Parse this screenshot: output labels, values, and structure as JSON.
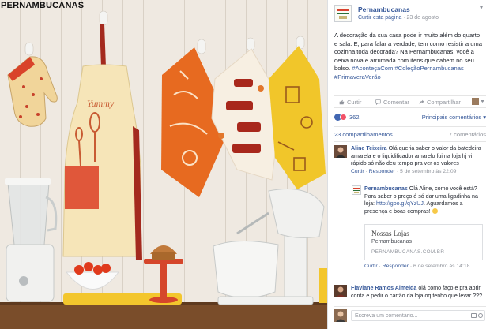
{
  "photo": {
    "brand_overlay": "PERNAMBUCANAS",
    "apron_text": "Yummy"
  },
  "post": {
    "page_name": "Pernambucanas",
    "like_page": "Curtir esta página",
    "separator": "·",
    "date": "23 de agosto",
    "text_plain": "A decoração da sua casa pode ir muito além do quarto e sala. E, para falar a verdade, tem como resistir a uma cozinha toda decorada? Na Pernambucanas, você a deixa nova e arrumada com itens que cabem no seu bolso.",
    "hashtags": "#AconteçaCom #ColeçãoPernambucanas #PrimaveraVerão"
  },
  "actions": {
    "like": "Curtir",
    "comment": "Comentar",
    "share": "Compartilhar"
  },
  "reactions": {
    "count": "362",
    "top_comments": "Principais comentários ▾"
  },
  "counts": {
    "shares": "23 compartilhamentos",
    "comments": "7 comentários"
  },
  "comments": [
    {
      "author": "Aline Teixeira",
      "text": "Olá queria saber o valor da batedeira amarela e o liquidificador amarelo fui na loja hj vi rápido só não deu tempo pra ver os valores",
      "like": "Curtir",
      "reply": "Responder",
      "time": "5 de setembro às 22:09"
    },
    {
      "author": "Pernambucanas",
      "text_before_link": "Olá Aline, como você está? Para saber o preço é só dar uma ligadinha na loja:",
      "link": "http://goo.gl/qYzUJ",
      "text_after_link": ". Aguardamos a presença e boas compras!",
      "like": "Curtir",
      "reply": "Responder",
      "time": "6 de setembro às 14:18",
      "card": {
        "title": "Nossas Lojas",
        "description": "Pernambucanas",
        "url": "PERNAMBUCANAS.COM.BR"
      }
    },
    {
      "author": "Flaviane Ramos Almeida",
      "text": "olá como faço e pra abrir conta e pedir o cartão da loja oq tenho que levar ???"
    }
  ],
  "composer": {
    "placeholder": "Escreva um comentário..."
  },
  "colors": {
    "link": "#365899",
    "like_blue": "#4267b2",
    "love_red": "#f25268",
    "muted": "#90949c"
  }
}
